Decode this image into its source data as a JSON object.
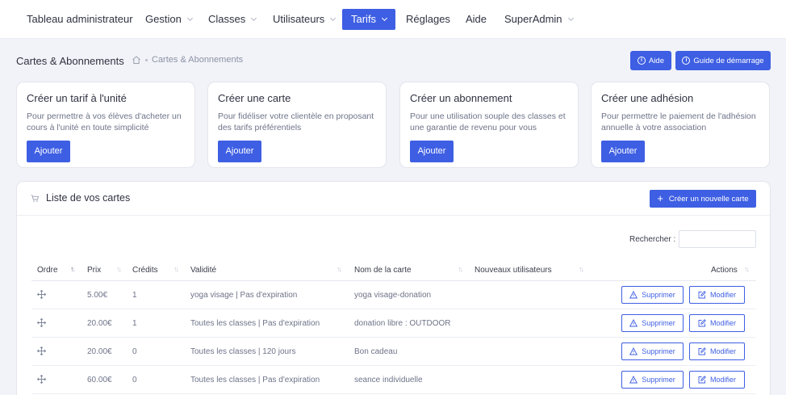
{
  "nav": {
    "items": [
      {
        "label": "Tableau administrateur",
        "has_dropdown": false,
        "active": false
      },
      {
        "label": "Gestion",
        "has_dropdown": true,
        "active": false
      },
      {
        "label": "Classes",
        "has_dropdown": true,
        "active": false
      },
      {
        "label": "Utilisateurs",
        "has_dropdown": true,
        "active": false
      },
      {
        "label": "Tarifs",
        "has_dropdown": true,
        "active": true
      },
      {
        "label": "Réglages",
        "has_dropdown": false,
        "active": false
      },
      {
        "label": "Aide",
        "has_dropdown": false,
        "active": false
      },
      {
        "label": "SuperAdmin",
        "has_dropdown": true,
        "active": false
      }
    ]
  },
  "header": {
    "title": "Cartes & Abonnements",
    "breadcrumb": "Cartes & Abonnements",
    "help_label": "Aide",
    "guide_label": "Guide de démarrage"
  },
  "cards": [
    {
      "title": "Créer un tarif à l'unité",
      "description": "Pour permettre à vos élèves d'acheter un cours à l'unité en toute simplicité",
      "button": "Ajouter"
    },
    {
      "title": "Créer une carte",
      "description": "Pour fidéliser votre clientèle en proposant des tarifs préférentiels",
      "button": "Ajouter"
    },
    {
      "title": "Créer un abonnement",
      "description": "Pour une utilisation souple des classes et une garantie de revenu pour vous",
      "button": "Ajouter"
    },
    {
      "title": "Créer une adhésion",
      "description": "Pour permettre le paiement de l'adhésion annuelle à votre association",
      "button": "Ajouter"
    }
  ],
  "list": {
    "title": "Liste de vos cartes",
    "create_button": "Créer un nouvelle carte",
    "search_label": "Rechercher :",
    "search_value": "",
    "columns": [
      "Ordre",
      "Prix",
      "Crédits",
      "Validité",
      "Nom de la carte",
      "Nouveaux utilisateurs",
      "Actions"
    ],
    "delete_label": "Supprimer",
    "edit_label": "Modifier",
    "rows": [
      {
        "prix": "5.00€",
        "credits": "1",
        "validite": "yoga visage | Pas d'expiration",
        "nom": "yoga visage-donation",
        "nouveaux": ""
      },
      {
        "prix": "20.00€",
        "credits": "1",
        "validite": "Toutes les classes | Pas d'expiration",
        "nom": "donation libre : OUTDOOR",
        "nouveaux": ""
      },
      {
        "prix": "20.00€",
        "credits": "0",
        "validite": "Toutes les classes | 120 jours",
        "nom": "Bon cadeau",
        "nouveaux": ""
      },
      {
        "prix": "60.00€",
        "credits": "0",
        "validite": "Toutes les classes | Pas d'expiration",
        "nom": "seance individuelle",
        "nouveaux": ""
      }
    ]
  },
  "colors": {
    "accent": "#3e5fe3",
    "background": "#f2f3f8"
  }
}
